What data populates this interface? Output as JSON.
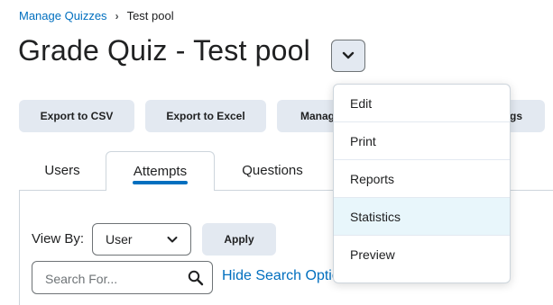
{
  "breadcrumb": {
    "parent": "Manage Quizzes",
    "separator": "›",
    "current": "Test pool"
  },
  "page_title": "Grade Quiz - Test pool",
  "actions": [
    {
      "label": "Export to CSV"
    },
    {
      "label": "Export to Excel"
    },
    {
      "label": "Manag"
    },
    {
      "label": "gs"
    }
  ],
  "tabs": [
    {
      "label": "Users",
      "active": false
    },
    {
      "label": "Attempts",
      "active": true
    },
    {
      "label": "Questions",
      "active": false
    }
  ],
  "filter": {
    "view_by_label": "View By:",
    "view_by_value": "User",
    "apply_label": "Apply"
  },
  "search": {
    "placeholder": "Search For...",
    "hide_options_label": "Hide Search Optio"
  },
  "menu": {
    "items": [
      {
        "label": "Edit"
      },
      {
        "label": "Print"
      },
      {
        "label": "Reports"
      },
      {
        "label": "Statistics",
        "highlighted": true
      },
      {
        "label": "Preview"
      }
    ]
  },
  "colors": {
    "link": "#006fbf",
    "button_bg": "#e3e9f1",
    "menu_highlight": "#e8f6fb"
  }
}
